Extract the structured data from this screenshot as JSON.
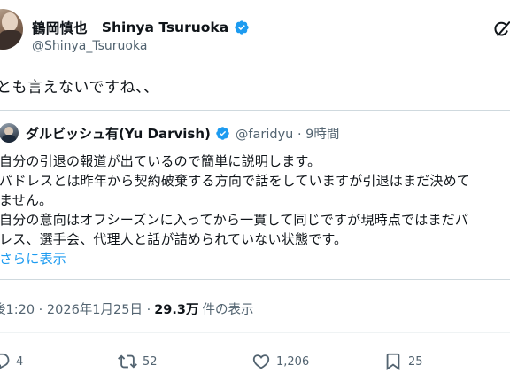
{
  "author": {
    "name_jp": "鶴岡慎也",
    "name_en": "Shinya Tsuruoka",
    "handle": "@Shinya_Tsuruoka"
  },
  "tweet": {
    "text": "とも言えないですね、、"
  },
  "quoted": {
    "name": "ダルビッシュ有(Yu Darvish)",
    "handle_time": "@faridyu · 9時間",
    "lines": [
      "自分の引退の報道が出ているので簡単に説明します。",
      "パドレスとは昨年から契約破棄する方向で話をしていますが引退はまだ決めて",
      "ません。",
      "自分の意向はオフシーズンに入ってから一貫して同じですが現時点ではまだパ",
      "レス、選手会、代理人と話が詰められていない状態です。"
    ],
    "show_more": "さらに表示"
  },
  "meta": {
    "timestamp": "後1:20 · 2026年1月25日 · ",
    "views": "29.3万",
    "views_label": "件の表示"
  },
  "actions": {
    "reply_count": "4",
    "repost_count": "52",
    "like_count": "1,206",
    "bookmark_count": "25"
  },
  "colors": {
    "accent": "#1d9bf0",
    "text": "#0f1419",
    "secondary": "#536471",
    "border": "#cfd9de"
  },
  "icons": {
    "verified": "verified-badge-icon",
    "grok": "grok-icon",
    "reply": "reply-icon",
    "repost": "repost-icon",
    "like": "heart-icon",
    "bookmark": "bookmark-icon"
  }
}
